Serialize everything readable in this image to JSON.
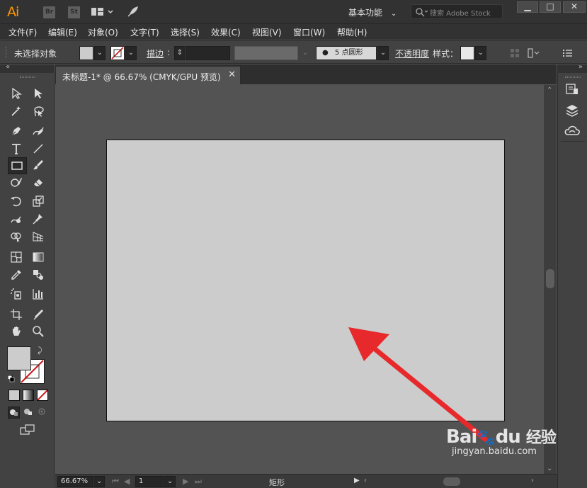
{
  "titlebar": {
    "logo": "Ai",
    "bridge": "Br",
    "stock": "St",
    "workspace": "基本功能",
    "search_placeholder": "搜索 Adobe Stock",
    "minimize": "▁",
    "maximize": "□",
    "close": "✕"
  },
  "menubar": {
    "items": [
      "文件(F)",
      "编辑(E)",
      "对象(O)",
      "文字(T)",
      "选择(S)",
      "效果(C)",
      "视图(V)",
      "窗口(W)",
      "帮助(H)"
    ]
  },
  "controlbar": {
    "selection": "未选择对象",
    "stroke_label": "描边",
    "stroke_value": "",
    "brush": "5 点圆形",
    "opacity_label": "不透明度",
    "style_label": "样式："
  },
  "document": {
    "tab_title": "未标题-1* @ 66.67% (CMYK/GPU 预览)",
    "tab_close": "✕"
  },
  "statusbar": {
    "zoom": "66.67%",
    "artboard_number": "1",
    "tool_name": "矩形"
  },
  "watermark": {
    "brand": "Bai",
    "brand2": "du",
    "suffix": "经验",
    "url": "jingyan.baidu.com"
  },
  "colors": {
    "fill": "#cccccc",
    "artboard": "#cccccc",
    "arrow": "#e8292c",
    "accent": "#ff9a00"
  },
  "icons": [
    "ai-logo",
    "bridge-icon",
    "stock-icon",
    "arrange-icon",
    "rocket-icon",
    "search-icon",
    "selection-tool-icon",
    "direct-selection-tool-icon",
    "magic-wand-icon",
    "lasso-icon",
    "pen-icon",
    "curvature-icon",
    "type-icon",
    "line-icon",
    "rectangle-icon",
    "paintbrush-icon",
    "shaper-icon",
    "eraser-icon",
    "rotate-icon",
    "scale-icon",
    "warp-icon",
    "puppet-warp-icon",
    "shape-builder-icon",
    "perspective-icon",
    "mesh-icon",
    "gradient-icon",
    "eyedropper-icon",
    "blend-icon",
    "symbol-sprayer-icon",
    "graph-icon",
    "artboard-icon",
    "slice-icon",
    "hand-icon",
    "zoom-icon",
    "properties-icon",
    "layers-icon",
    "cc-libraries-icon"
  ]
}
